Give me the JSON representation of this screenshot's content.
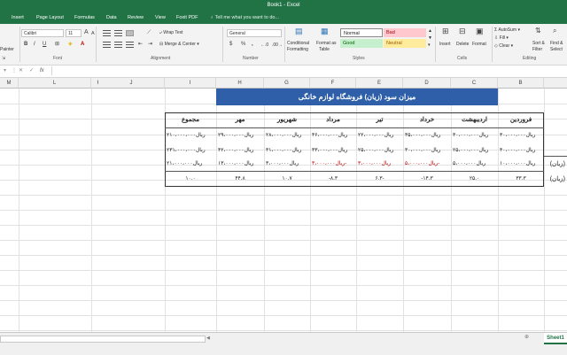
{
  "window": {
    "title": "Book1 - Excel"
  },
  "tabs": [
    "Insert",
    "Page Layout",
    "Formulas",
    "Data",
    "Review",
    "View",
    "Foxit PDF"
  ],
  "tell_me": "Tell me what you want to do...",
  "ribbon": {
    "clipboard": {
      "painter": "Painter",
      "label": "Clipboard"
    },
    "font": {
      "name": "Calibri",
      "size": "11",
      "bold": "B",
      "italic": "I",
      "underline": "U",
      "grow": "A",
      "shrink": "A",
      "label": "Font"
    },
    "alignment": {
      "wrap_text": "Wrap Text",
      "merge_center": "Merge & Center",
      "label": "Alignment"
    },
    "number": {
      "format": "General",
      "currency": "$",
      "percent": "%",
      "comma": ",",
      "label": "Number"
    },
    "styles": {
      "conditional": "Conditional",
      "conditional2": "Formatting",
      "format_as": "Format as",
      "format_as2": "Table",
      "normal": "Normal",
      "bad": "Bad",
      "good": "Good",
      "neutral": "Neutral",
      "label": "Styles",
      "colors": {
        "bad_bg": "#ffc7ce",
        "bad_fg": "#9c0006",
        "good_bg": "#c6efce",
        "good_fg": "#006100",
        "neutral_bg": "#ffeb9c",
        "neutral_fg": "#9c5700"
      }
    },
    "cells": {
      "insert": "Insert",
      "delete": "Delete",
      "format": "Format",
      "label": "Cells"
    },
    "editing": {
      "autosum": "AutoSum",
      "fill": "Fill",
      "clear": "Clear",
      "sort": "Sort &",
      "sort2": "Filter",
      "find": "Find &",
      "find2": "Select",
      "label": "Editing"
    }
  },
  "formula_bar": {
    "cancel": "✕",
    "enter": "✓",
    "fx": "fx",
    "value": ""
  },
  "columns": [
    "M",
    "L",
    "K",
    "J",
    "I",
    "H",
    "G",
    "F",
    "E",
    "D",
    "C",
    "B"
  ],
  "sheet": {
    "title": "میزان سود (زیان) فروشگاه لوازم خانگی",
    "headers": [
      "فروردین",
      "اردیبهشت",
      "خرداد",
      "تیر",
      "مرداد",
      "شهریور",
      "مهر",
      "مجموع"
    ],
    "row1": [
      "۳۰،۰۰۰،۰۰۰ریال",
      "۳۰،۰۰۰،۰۰۰ریال",
      "۳۵،۰۰۰،۰۰۰ریال",
      "۲۲،۰۰۰،۰۰۰ریال",
      "۳۶،۰۰۰،۰۰۰ریال",
      "۲۸،۰۰۰،۰۰۰ریال",
      "۲۹،۰۰۰،۰۰۰ریال",
      "۲۱۰،۰۰۰،۰۰۰ریال"
    ],
    "row2": [
      "۴۰،۰۰۰،۰۰۰ریال",
      "۲۵،۰۰۰،۰۰۰ریال",
      "۳۰،۰۰۰،۰۰۰ریال",
      "۲۵،۰۰۰،۰۰۰ریال",
      "۳۳،۰۰۰،۰۰۰ریال",
      "۳۱،۰۰۰،۰۰۰ریال",
      "۴۲،۰۰۰،۰۰۰ریال",
      "۲۳۱،۰۰۰،۰۰۰ریال"
    ],
    "row3": [
      "۱۰،۰۰۰،۰۰۰ریال",
      "۵،۰۰۰،۰۰۰ریال",
      "۵،۰۰۰،۰۰۰ریال-",
      "۳،۰۰۰،۰۰۰ریال",
      "۳،۰۰۰،۰۰۰ریال-",
      "۳،۰۰۰،۰۰۰ریال",
      "۱۳،۰۰۰،۰۰۰ریال",
      "۲۱،۰۰۰،۰۰۰ریال"
    ],
    "row3_label": "(زیان)",
    "row4": [
      "۳۳.۳",
      "۲۵.۰",
      "-۱۴.۳",
      "۶.۳-",
      "-۸.۳",
      "۱۰.۷",
      "۴۴.۸",
      "۱۰.۰"
    ],
    "row4_label": "(زیان)",
    "banner_color": "#2e5fa8",
    "negative_color": "#c00000"
  },
  "status": {
    "sheet_tab": "Sheet1",
    "add_sheet": "⊕"
  }
}
